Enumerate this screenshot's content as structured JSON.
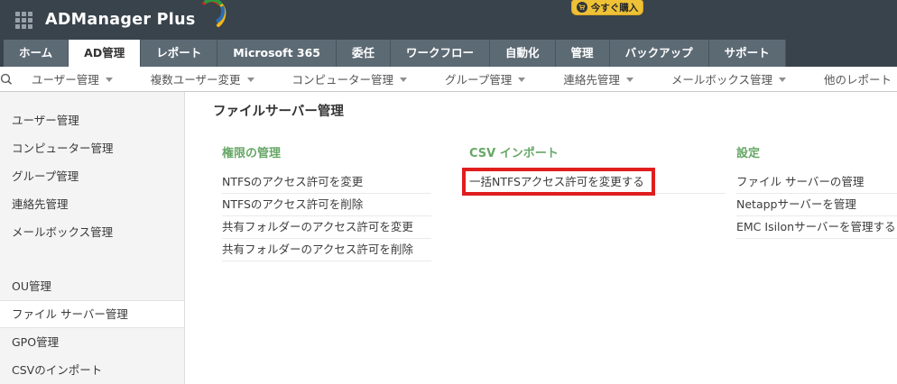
{
  "topbar": {
    "app_name": "ADManager Plus",
    "buy_label": "今すぐ購入"
  },
  "tabs": {
    "active": "AD管理",
    "items": [
      "ホーム",
      "AD管理",
      "レポート",
      "Microsoft 365",
      "委任",
      "ワークフロー",
      "自動化",
      "管理",
      "バックアップ",
      "サポート"
    ]
  },
  "menubar": {
    "items": [
      "ユーザー管理",
      "複数ユーザー変更",
      "コンピューター管理",
      "グループ管理",
      "連絡先管理",
      "メールボックス管理",
      "他のレポート"
    ]
  },
  "sidebar": {
    "selected": "ファイル サーバー管理",
    "items": [
      "ユーザー管理",
      "コンピューター管理",
      "グループ管理",
      "連絡先管理",
      "メールボックス管理",
      "OU管理",
      "ファイル サーバー管理",
      "GPO管理",
      "CSVのインポート"
    ]
  },
  "main": {
    "title": "ファイルサーバー管理",
    "columns": [
      {
        "heading": "権限の管理",
        "links": [
          "NTFSのアクセス許可を変更",
          "NTFSのアクセス許可を削除",
          "共有フォルダーのアクセス許可を変更",
          "共有フォルダーのアクセス許可を削除"
        ]
      },
      {
        "heading": "CSV インポート",
        "links": [
          "一括NTFSアクセス許可を変更する"
        ],
        "highlighted_link": "一括NTFSアクセス許可を変更する"
      },
      {
        "heading": "設定",
        "links": [
          "ファイル サーバーの管理",
          "Netappサーバーを管理",
          "EMC Isilonサーバーを管理する"
        ]
      }
    ]
  },
  "icons": {
    "grid": "app-launcher-grid-icon",
    "cart": "shopping-cart-icon",
    "search": "search-icon",
    "chevron": "chevron-down-icon",
    "logo_swirl": "brand-swirl-icon"
  },
  "colors": {
    "topbar_bg": "#39434c",
    "tab_bg": "#5c6a74",
    "active_tab_bg": "#ffffff",
    "buy_yellow": "#eec137",
    "heading_green": "#67a767",
    "highlight_red": "#e01e1e",
    "sidebar_bg": "#f4f4f4"
  }
}
